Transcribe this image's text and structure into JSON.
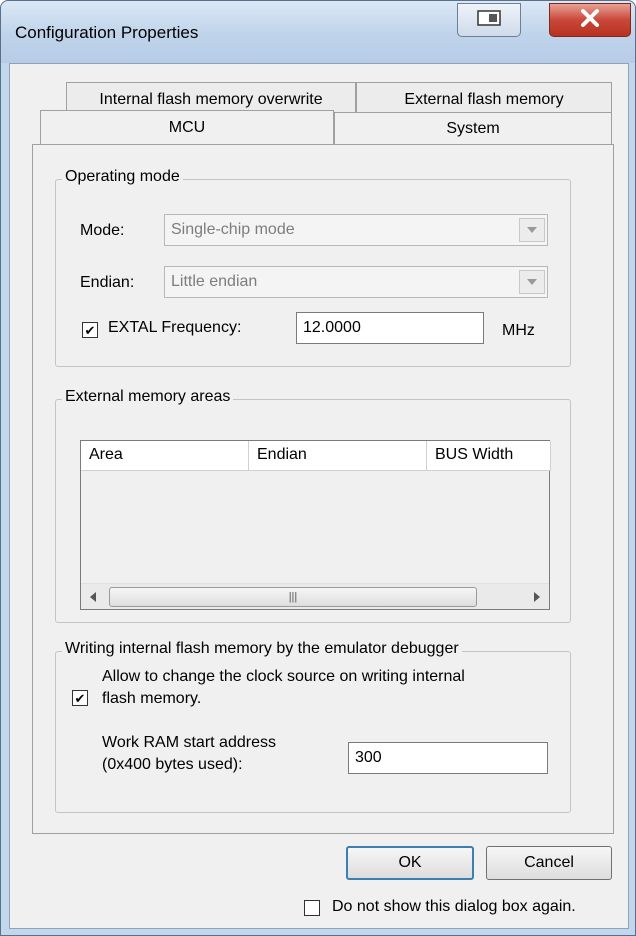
{
  "window": {
    "title": "Configuration Properties"
  },
  "tabs": {
    "row1": [
      "Internal flash memory overwrite",
      "External flash memory"
    ],
    "row2": [
      "MCU",
      "System"
    ],
    "active": "MCU"
  },
  "operating_mode": {
    "legend": "Operating mode",
    "mode_label": "Mode:",
    "mode_value": "Single-chip mode",
    "endian_label": "Endian:",
    "endian_value": "Little endian",
    "extal_label": "EXTAL Frequency:",
    "extal_checked": true,
    "extal_value": "12.0000",
    "extal_unit": "MHz"
  },
  "external_memory": {
    "legend": "External memory areas",
    "columns": [
      "Area",
      "Endian",
      "BUS Width"
    ],
    "rows": []
  },
  "flash_writing": {
    "legend": "Writing internal flash memory by the emulator debugger",
    "allow_label_line1": "Allow to change the clock source on writing internal",
    "allow_label_line2": "flash memory.",
    "allow_checked": true,
    "work_ram_label_line1": "Work RAM start address",
    "work_ram_label_line2": "(0x400 bytes used):",
    "work_ram_value": "300"
  },
  "buttons": {
    "ok": "OK",
    "cancel": "Cancel"
  },
  "footer": {
    "dont_show_label": "Do not show this dialog box again.",
    "dont_show_checked": false
  },
  "icons": {
    "check": "✔",
    "close": "close-x",
    "restore": "restore"
  },
  "colors": {
    "title_gradient_top": "#dbe8f6",
    "close_button": "#c9483a",
    "client_bg": "#f0f0f0",
    "default_button_border": "#3c7fb1"
  }
}
